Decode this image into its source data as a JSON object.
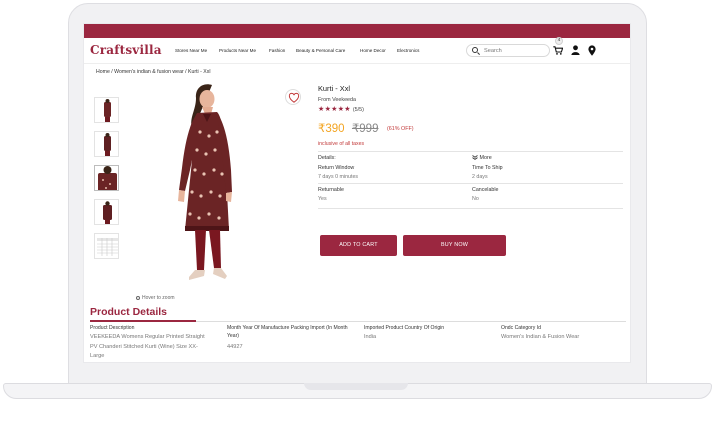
{
  "brand": {
    "logo_text": "Craftsvilla",
    "accent": "#9b2740"
  },
  "nav": {
    "items": [
      "Stores Near Me",
      "Products Near Me",
      "Fashion",
      "Beauty & Personal Care",
      "Home Decor",
      "Electronics"
    ],
    "search_placeholder": "Search",
    "cart_count": "4",
    "icons": [
      "search-icon",
      "cart-icon",
      "user-icon",
      "location-pin-icon"
    ]
  },
  "breadcrumb": "Home / Women's indian & fusion wear / Kurti - Xxl",
  "gallery": {
    "hover_hint": "Hover to zoom",
    "thumbnail_count": 5
  },
  "product": {
    "title": "Kurti - Xxl",
    "seller": "From Veekeeda",
    "stars": "★★★★★",
    "rating": "(5/5)",
    "price": "₹390",
    "mrp": "₹999",
    "discount": "(61% OFF)",
    "taxes": "inclusive of all taxes",
    "details_label": "Details:",
    "more_label": "More",
    "return_label": "Return Window",
    "return_value": "7 days 0 minutes",
    "ship_label": "Time To Ship",
    "ship_value": "2 days",
    "returnable_label": "Returnable",
    "returnable_value": "Yes",
    "cancelable_label": "Cancelable",
    "cancelable_value": "No",
    "add_to_cart": "ADD TO CART",
    "buy_now": "BUY NOW"
  },
  "product_details": {
    "heading": "Product Details",
    "columns": [
      {
        "label": "Product Description",
        "value": "VEEKEEDA Womens Regular Printed Straight PV Chanderi Stitched Kurti (Wine) Size XX-Large"
      },
      {
        "label": "Month Year Of Manufacture Packing Import (In Month Year)",
        "value": "44927"
      },
      {
        "label": "Imported Product Country Of Origin",
        "value": "India"
      },
      {
        "label": "Ondc Category Id",
        "value": "Women's Indian & Fusion Wear"
      }
    ]
  }
}
